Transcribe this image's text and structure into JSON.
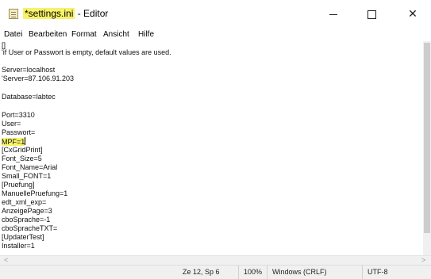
{
  "window": {
    "title_file": "*settings.ini",
    "title_suffix": " - Editor",
    "minimize_symbol": "",
    "maximize_symbol": "",
    "close_symbol": "✕"
  },
  "menu": {
    "items": [
      "Datei",
      "Bearbeiten",
      "Format",
      "Ansicht",
      "Hilfe"
    ]
  },
  "editor": {
    "highlight_color": "#f7f26a",
    "lines": [
      "[]",
      "'if User or Passwort is empty, default values are used.",
      "",
      "Server=localhost",
      "'Server=87.106.91.203",
      "",
      "Database=labtec",
      "",
      "Port=3310",
      "User=",
      "Passwort=",
      "MPF=1",
      "[CxGridPrint]",
      "Font_Size=5",
      "Font_Name=Arial",
      "Small_FONT=1",
      "[Pruefung]",
      "ManuellePruefung=1",
      "edt_xml_exp=",
      "AnzeigePage=3",
      "cboSprache=-1",
      "cboSpracheTXT=",
      "[UpdaterTest]",
      "Installer=1"
    ]
  },
  "scrollbar": {
    "left_arrow": "<",
    "right_arrow": ">"
  },
  "status": {
    "position": "Ze 12, Sp 6",
    "zoom": "100%",
    "line_ending": "Windows (CRLF)",
    "encoding": "UTF-8"
  }
}
